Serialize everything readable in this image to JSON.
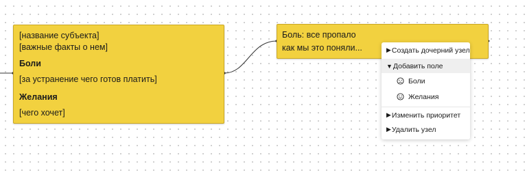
{
  "canvas": {
    "background": "#ffffff",
    "grid_dot_color": "#c9c9c9"
  },
  "nodes": {
    "subject": {
      "name_placeholder": "[название субъекта]",
      "facts_placeholder": "[важные факты о нем]",
      "pains_heading": "Боли",
      "pains_placeholder": "[за устранение чего готов платить]",
      "wishes_heading": "Желания",
      "wishes_placeholder": "[чего хочет]",
      "color": "#f2d13f"
    },
    "pain": {
      "line1": "Боль: все пропало",
      "line2": "как мы это поняли...",
      "color": "#f2d13f"
    }
  },
  "context_menu": {
    "create_child": "Создать дочерний узел",
    "add_field": "Добавить поле",
    "add_field_options": [
      {
        "label": "Боли",
        "icon": "frown-icon"
      },
      {
        "label": "Желания",
        "icon": "smile-icon"
      }
    ],
    "change_priority": "Изменить приоритет",
    "delete_node": "Удалить узел"
  }
}
